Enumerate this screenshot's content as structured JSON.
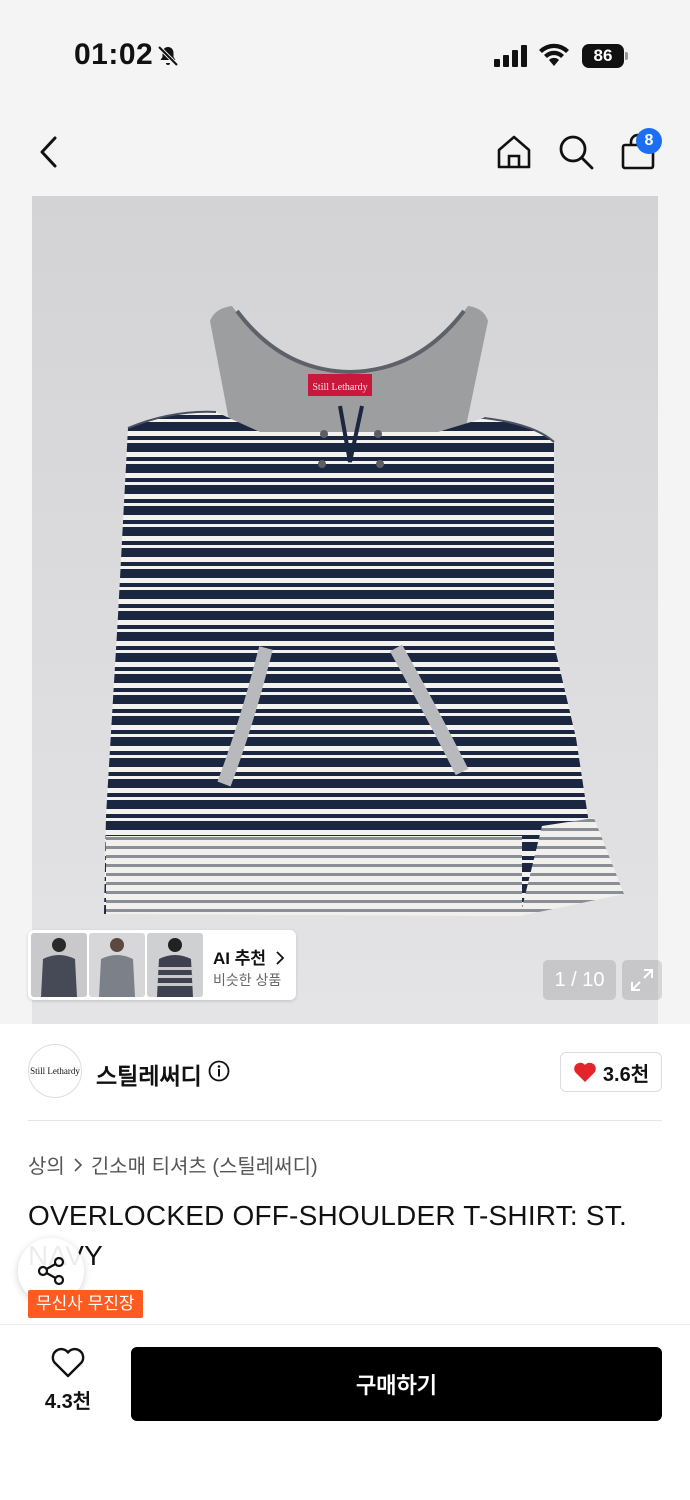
{
  "status": {
    "time": "01:02",
    "battery": "86"
  },
  "nav": {
    "cart_count": "8"
  },
  "ai_recommend": {
    "title": "AI 추천",
    "subtitle": "비슷한 상품"
  },
  "gallery": {
    "counter": "1 / 10"
  },
  "brand": {
    "logo_text": "Still Lethardy",
    "name": "스틸레써디",
    "likes": "3.6천"
  },
  "breadcrumb": {
    "category": "상의",
    "subcategory": "긴소매 티셔츠 (스틸레써디)"
  },
  "product": {
    "title": "OVERLOCKED OFF-SHOULDER T-SHIRT: ST. NAVY",
    "shipping_badge": "무신사 무진장"
  },
  "product_label": "Still Lethardy",
  "bottom": {
    "wish_count": "4.3천",
    "buy_label": "구매하기"
  },
  "colors": {
    "accent": "#1c6ef2",
    "badge": "#ff5a1f",
    "heart": "#e3242b"
  },
  "icons": [
    "back-icon",
    "home-icon",
    "search-icon",
    "bag-icon",
    "info-icon",
    "heart-icon",
    "share-icon",
    "expand-icon"
  ]
}
